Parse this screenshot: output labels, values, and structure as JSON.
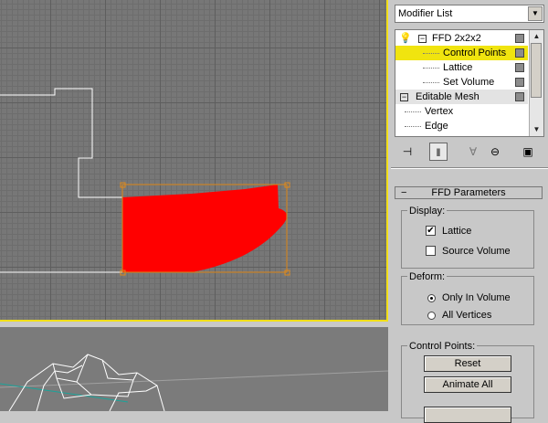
{
  "modifier_list": {
    "label": "Modifier List"
  },
  "stack": {
    "items": [
      {
        "label": "FFD 2x2x2"
      },
      {
        "label": "Control Points"
      },
      {
        "label": "Lattice"
      },
      {
        "label": "Set Volume"
      },
      {
        "label": "Editable Mesh"
      },
      {
        "label": "Vertex"
      },
      {
        "label": "Edge"
      }
    ]
  },
  "toolbar": {
    "icons": [
      "pin-stack-icon",
      "show-end-result-icon",
      "make-unique-icon",
      "remove-modifier-icon",
      "configure-modifier-sets-icon"
    ]
  },
  "ffd": {
    "rollout_title": "FFD Parameters",
    "display": {
      "title": "Display:",
      "lattice": {
        "label": "Lattice",
        "checked": true
      },
      "source_volume": {
        "label": "Source Volume",
        "checked": false
      }
    },
    "deform": {
      "title": "Deform:",
      "only_in_volume": {
        "label": "Only In Volume",
        "selected": true
      },
      "all_vertices": {
        "label": "All Vertices",
        "selected": false
      }
    },
    "control_points": {
      "title": "Control Points:",
      "reset": "Reset",
      "animate_all": "Animate All"
    }
  },
  "colors": {
    "viewport_border_active": "#f2df17",
    "selected_item": "#f0e40f",
    "mesh": "#ff0000",
    "lattice": "#e08a1a"
  }
}
